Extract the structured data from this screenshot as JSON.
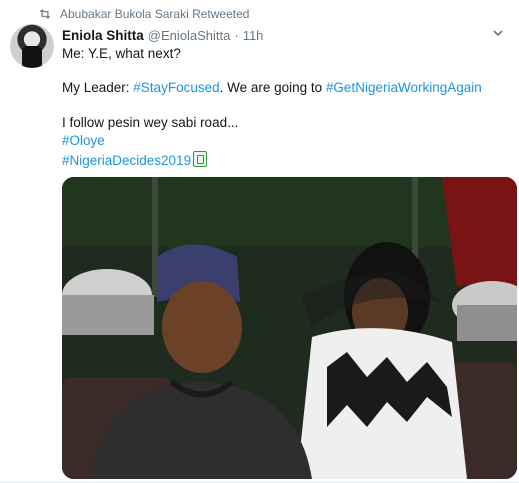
{
  "retweet": {
    "icon": "retweet-icon",
    "text": "Abubakar Bukola Saraki Retweeted"
  },
  "tweet": {
    "author_name": "Eniola Shitta",
    "author_handle": "@EniolaShitta",
    "separator": "·",
    "timestamp": "11h",
    "lines": {
      "l1": "Me: Y.E, what next?",
      "l2_pre": "My Leader: ",
      "l2_tag1": "#StayFocused",
      "l2_mid": ". We are going to ",
      "l2_tag2": "#GetNigeriaWorkingAgain",
      "l3": "I follow pesin wey sabi road...",
      "l4_tag": "#Oloye",
      "l5_tag": "#NigeriaDecides2019"
    },
    "hashtag_color": "#1b95e0"
  },
  "icons": {
    "more": "chevron-down-icon",
    "hashtag_emoji": "nigeria-decides-emoji-icon"
  }
}
